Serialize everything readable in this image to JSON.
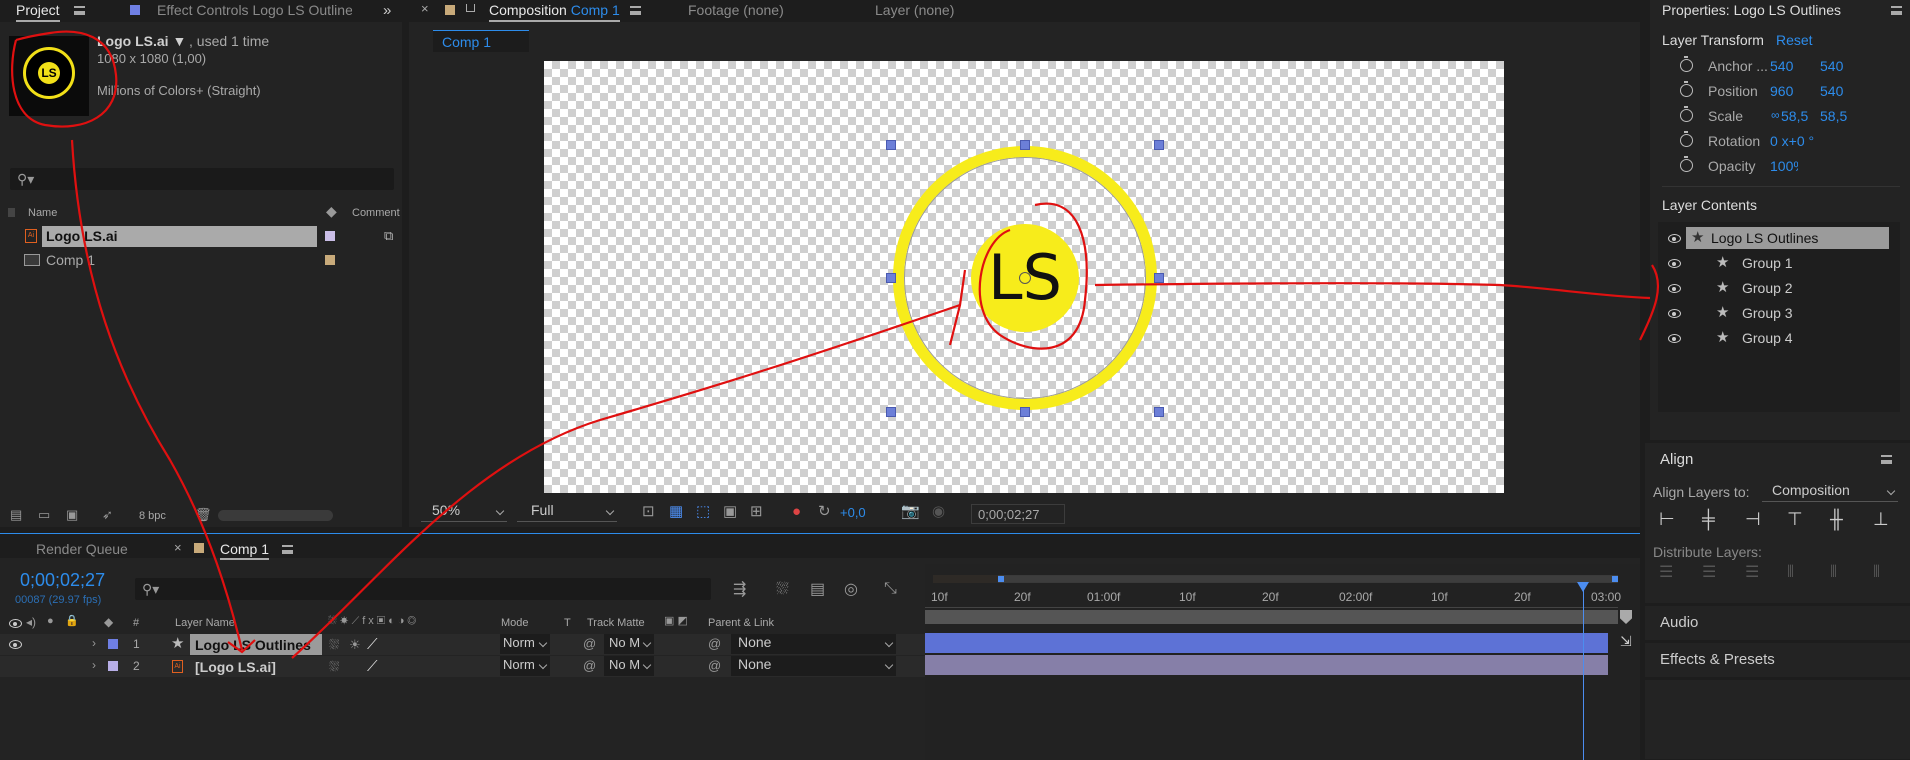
{
  "project": {
    "tab_label": "Project",
    "effect_controls_tab": "Effect Controls Logo LS Outlines",
    "item_name": "Logo LS.ai ▼",
    "item_used": ", used 1 time",
    "item_dims": "1080 x 1080 (1,00)",
    "item_colors": "Millions of Colors+ (Straight)",
    "col_name": "Name",
    "col_comment": "Comment",
    "items": [
      {
        "name": "Logo LS.ai",
        "swatch": "#c9bde6"
      },
      {
        "name": "Comp 1",
        "swatch": "#c8aa7a"
      }
    ],
    "bpc": "8 bpc",
    "thumb_text": "LS"
  },
  "composition": {
    "tab_prefix": "Composition",
    "tab_comp": "Comp 1",
    "footage_tab": "Footage  (none)",
    "layer_tab": "Layer  (none)",
    "sub_tab": "Comp 1",
    "logo_text": "LS",
    "zoom": "50%",
    "resolution": "Full",
    "exposure": "+0,0",
    "timecode": "0;00;02;27"
  },
  "properties": {
    "title": "Properties: Logo LS Outlines",
    "section": "Layer Transform",
    "reset": "Reset",
    "rows": [
      {
        "label": "Anchor ...",
        "v1": "540",
        "v2": "540"
      },
      {
        "label": "Position",
        "v1": "960",
        "v2": "540"
      },
      {
        "label": "Scale",
        "v1": "58,5",
        "v2": "58,5"
      },
      {
        "label": "Rotation",
        "v1": "0 x+0 °",
        "v2": ""
      },
      {
        "label": "Opacity",
        "v1": "100%",
        "v2": ""
      }
    ],
    "contents_title": "Layer Contents",
    "contents": [
      {
        "label": "Logo LS Outlines"
      },
      {
        "label": "Group 1"
      },
      {
        "label": "Group 2"
      },
      {
        "label": "Group 3"
      },
      {
        "label": "Group 4"
      }
    ]
  },
  "align": {
    "title": "Align",
    "align_to_label": "Align Layers to:",
    "align_to_value": "Composition",
    "distribute_label": "Distribute Layers:",
    "audio": "Audio",
    "effects": "Effects & Presets"
  },
  "timeline": {
    "render_queue": "Render Queue",
    "comp_tab": "Comp 1",
    "timecode": "0;00;02;27",
    "frames": "00087 (29.97 fps)",
    "col_hash": "#",
    "col_layer_name": "Layer Name",
    "col_mode": "Mode",
    "col_t": "T",
    "col_track_matte": "Track Matte",
    "col_parent": "Parent & Link",
    "ruler": [
      "10f",
      "20f",
      "01:00f",
      "10f",
      "20f",
      "02:00f",
      "10f",
      "20f",
      "03:00"
    ],
    "layers": [
      {
        "num": "1",
        "name": "Logo LS Outlines",
        "label_color": "#6f7fe3",
        "mode": "Norm",
        "matte": "No M",
        "parent": "None"
      },
      {
        "num": "2",
        "name": "[Logo LS.ai]",
        "label_color": "#b7aee6",
        "mode": "Norm",
        "matte": "No M",
        "parent": "None"
      }
    ]
  }
}
